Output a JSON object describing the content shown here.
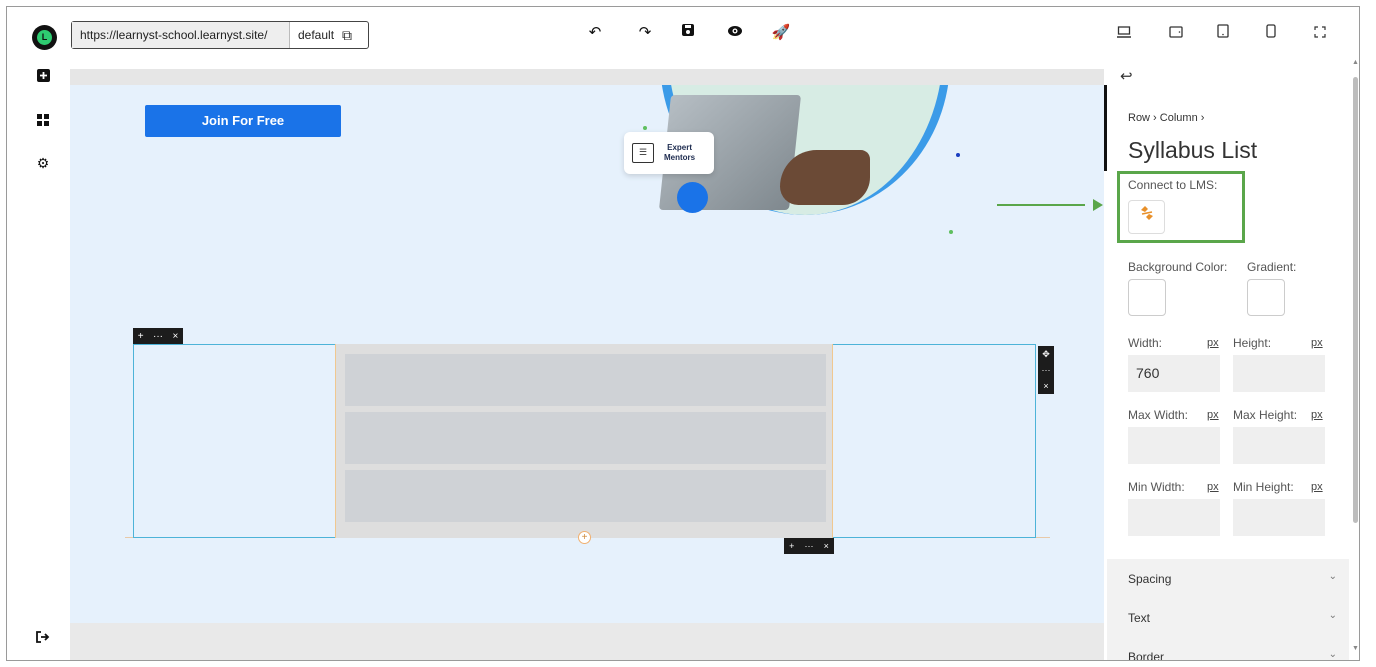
{
  "toolbar": {
    "url": "https://learnyst-school.learnyst.site/",
    "layout": "default",
    "icons": [
      "undo-icon",
      "redo-icon",
      "save-icon",
      "preview-icon",
      "publish-icon"
    ],
    "devices": [
      "desktop-icon",
      "tablet-landscape-icon",
      "tablet-icon",
      "mobile-icon",
      "fullscreen-icon"
    ]
  },
  "sidebar": {
    "items": [
      "add-element-icon",
      "widgets-icon",
      "settings-icon"
    ],
    "logout": "logout-icon"
  },
  "canvas": {
    "join_button": "Join For Free",
    "mentor_card": {
      "line1": "Expert",
      "line2": "Mentors"
    },
    "syllabus_items": 3
  },
  "panel": {
    "breadcrumb": "Row › Column ›",
    "title": "Syllabus List",
    "connect_label": "Connect to LMS:",
    "bg_color_label": "Background Color:",
    "gradient_label": "Gradient:",
    "width_label": "Width:",
    "height_label": "Height:",
    "unit": "px",
    "width_value": "760",
    "max_width_label": "Max Width:",
    "max_height_label": "Max Height:",
    "min_width_label": "Min Width:",
    "min_height_label": "Min Height:",
    "sections": [
      "Spacing",
      "Text",
      "Border"
    ]
  },
  "colors": {
    "accent": "#1a73e8",
    "highlight": "#5aa64a",
    "lms_icon": "#e8902a"
  }
}
